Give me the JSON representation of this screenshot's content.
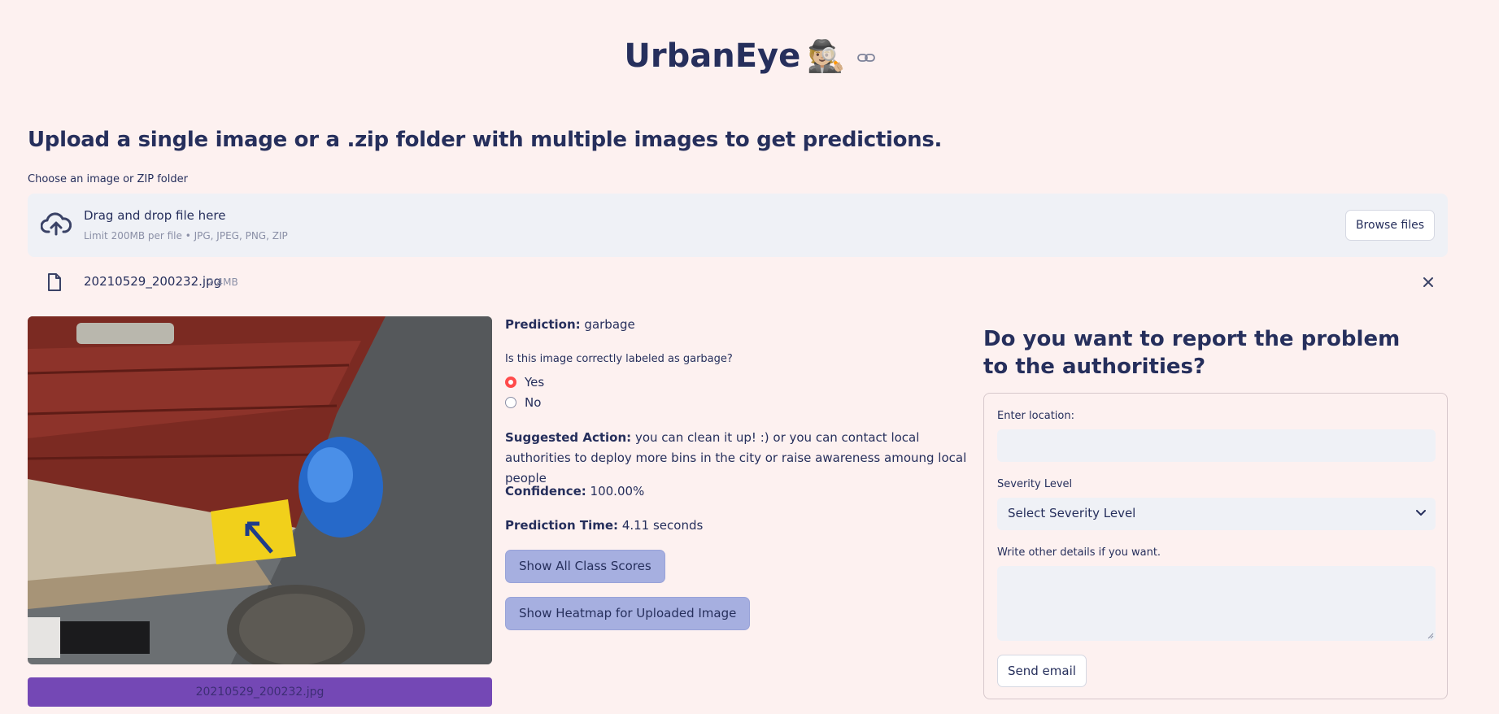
{
  "header": {
    "title": "UrbanEye",
    "emoji": "🕵🏼"
  },
  "subtitle": "Upload a single image or a .zip folder with multiple images to get predictions.",
  "uploader": {
    "label": "Choose an image or ZIP folder",
    "drop_text": "Drag and drop file here",
    "limit_text": "Limit 200MB per file • JPG, JPEG, PNG, ZIP",
    "browse_label": "Browse files",
    "file": {
      "name": "20210529_200232.jpg",
      "size": "2.4MB"
    }
  },
  "image": {
    "caption": "20210529_200232.jpg"
  },
  "prediction": {
    "prediction_label": "Prediction:",
    "prediction_value": "garbage",
    "question": "Is this image correctly labeled as garbage?",
    "options": [
      {
        "label": "Yes",
        "selected": true
      },
      {
        "label": "No",
        "selected": false
      }
    ],
    "action_label": "Suggested Action:",
    "action_value": "you can clean it up! :) or you can contact local authorities to deploy more bins in the city or raise awareness amoung local people",
    "confidence_label": "Confidence:",
    "confidence_value": "100.00%",
    "time_label": "Prediction Time:",
    "time_value": "4.11 seconds",
    "class_scores_button": "Show All Class Scores",
    "heatmap_button": "Show Heatmap for Uploaded Image"
  },
  "report": {
    "title": "Do you want to report the problem to the authorities?",
    "location_label": "Enter location:",
    "location_value": "",
    "severity_label": "Severity Level",
    "severity_placeholder": "Select Severity Level",
    "details_label": "Write other details if you want.",
    "details_value": "",
    "send_button": "Send email"
  },
  "colors": {
    "background": "#fdf1f0",
    "text": "#262f5c",
    "accent": "#ff4b4b",
    "button_lavender": "#a6afe0",
    "caption_purple": "#7448b5"
  }
}
